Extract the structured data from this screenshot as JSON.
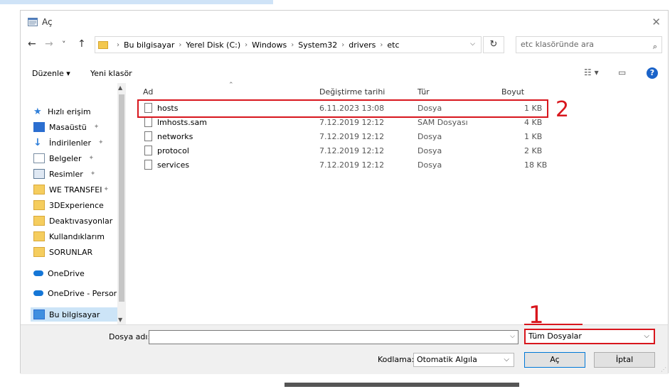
{
  "window": {
    "title": "Aç",
    "close_glyph": "✕"
  },
  "nav": {
    "back": "←",
    "forward": "→",
    "recent": "˅",
    "up": "↑",
    "breadcrumbs": [
      "Bu bilgisayar",
      "Yerel Disk (C:)",
      "Windows",
      "System32",
      "drivers",
      "etc"
    ],
    "refresh": "↻",
    "search_placeholder": "etc klasöründe ara",
    "search_icon": "⌕"
  },
  "toolbar": {
    "organize": "Düzenle ▾",
    "new_folder": "Yeni klasör",
    "view_icon": "☷ ▾",
    "pane_icon": "▭",
    "help": "?"
  },
  "sidebar": {
    "items": [
      {
        "label": "Hızlı erişim",
        "icon": "star-icon",
        "pinned": false
      },
      {
        "label": "Masaüstü",
        "icon": "desktop-icon",
        "pinned": true
      },
      {
        "label": "İndirilenler",
        "icon": "download-icon",
        "pinned": true
      },
      {
        "label": "Belgeler",
        "icon": "documents-icon",
        "pinned": true
      },
      {
        "label": "Resimler",
        "icon": "pictures-icon",
        "pinned": true
      },
      {
        "label": "WE TRANSFEI",
        "icon": "folder-icon",
        "pinned": true
      },
      {
        "label": "3DExperience",
        "icon": "folder-icon",
        "pinned": false
      },
      {
        "label": "Deaktıvasyonlar",
        "icon": "folder-icon",
        "pinned": false
      },
      {
        "label": "Kullandıklarım",
        "icon": "folder-icon",
        "pinned": false
      },
      {
        "label": "SORUNLAR",
        "icon": "folder-icon",
        "pinned": false
      },
      {
        "label": "OneDrive",
        "icon": "cloud-icon",
        "pinned": false
      },
      {
        "label": "OneDrive - Persor",
        "icon": "cloud-icon",
        "pinned": false
      },
      {
        "label": "Bu bilgisayar",
        "icon": "computer-icon",
        "pinned": false
      }
    ],
    "pin_glyph": "📌"
  },
  "columns": {
    "name": "Ad",
    "modified": "Değiştirme tarihi",
    "type": "Tür",
    "size": "Boyut"
  },
  "files": [
    {
      "name": "hosts",
      "modified": "6.11.2023 13:08",
      "type": "Dosya",
      "size": "1 KB"
    },
    {
      "name": "lmhosts.sam",
      "modified": "7.12.2019 12:12",
      "type": "SAM Dosyası",
      "size": "4 KB"
    },
    {
      "name": "networks",
      "modified": "7.12.2019 12:12",
      "type": "Dosya",
      "size": "1 KB"
    },
    {
      "name": "protocol",
      "modified": "7.12.2019 12:12",
      "type": "Dosya",
      "size": "2 KB"
    },
    {
      "name": "services",
      "modified": "7.12.2019 12:12",
      "type": "Dosya",
      "size": "18 KB"
    }
  ],
  "annotations": {
    "mark_1": "1",
    "mark_2": "2",
    "color": "#d8161d"
  },
  "bottom": {
    "filename_label": "Dosya adı:",
    "filename_value": "",
    "filetype_value": "Tüm Dosyalar",
    "encoding_label": "Kodlama:",
    "encoding_value": "Otomatik Algıla",
    "open_button": "Aç",
    "cancel_button": "İptal"
  }
}
